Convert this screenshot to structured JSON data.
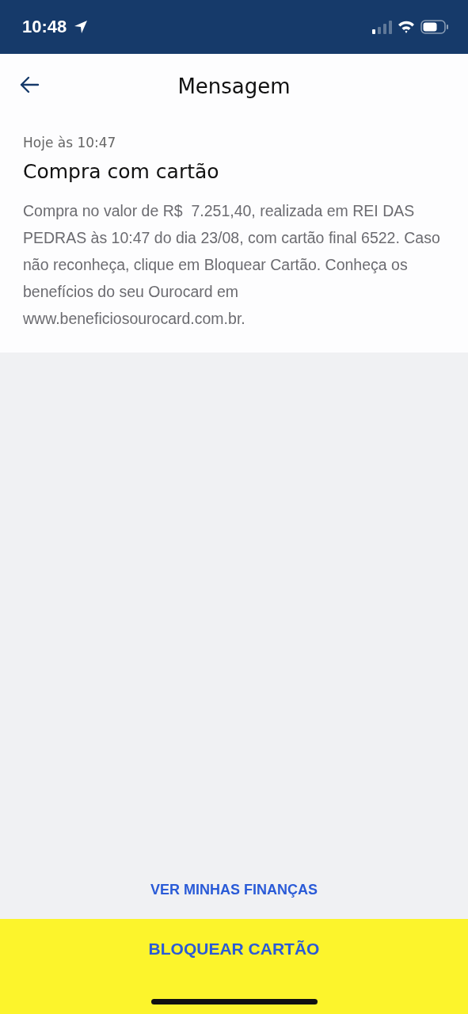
{
  "status_bar": {
    "time": "10:48"
  },
  "header": {
    "title": "Mensagem"
  },
  "message": {
    "timestamp": "Hoje às 10:47",
    "title": "Compra com cartão",
    "body": "Compra no valor de R$  7.251,40, realizada em REI DAS PEDRAS às 10:47 do dia 23/08, com cartão final 6522. Caso não reconheça, clique em Bloquear Cartão. Conheça os benefícios do seu Ourocard em www.beneficiosourocard.com.br."
  },
  "link": "VER MINHAS FINANÇAS",
  "primary_button": "BLOQUEAR CARTÃO"
}
